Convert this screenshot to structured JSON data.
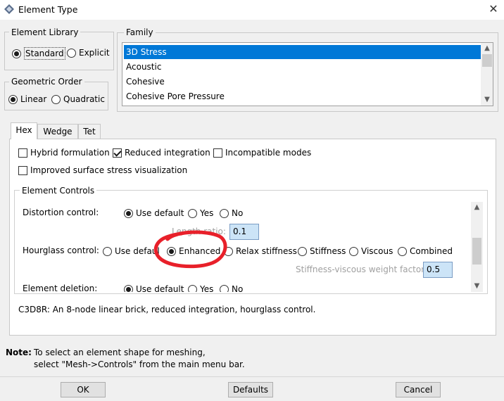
{
  "window": {
    "title": "Element Type",
    "close": "✕"
  },
  "element_library": {
    "title": "Element Library",
    "options": [
      "Standard",
      "Explicit"
    ],
    "selected": "Standard"
  },
  "geometric_order": {
    "title": "Geometric Order",
    "options": [
      "Linear",
      "Quadratic"
    ],
    "selected": "Linear"
  },
  "family": {
    "title": "Family",
    "items": [
      "3D Stress",
      "Acoustic",
      "Cohesive",
      "Cohesive Pore Pressure"
    ],
    "selected": "3D Stress"
  },
  "tabs": {
    "items": [
      "Hex",
      "Wedge",
      "Tet"
    ],
    "active": "Hex"
  },
  "options": {
    "hybrid": {
      "label": "Hybrid formulation",
      "checked": false
    },
    "reduced": {
      "label": "Reduced integration",
      "checked": true
    },
    "incompatible": {
      "label": "Incompatible modes",
      "checked": false
    },
    "improved": {
      "label": "Improved surface stress visualization",
      "checked": false
    }
  },
  "element_controls": {
    "title": "Element Controls",
    "distortion": {
      "label": "Distortion control:",
      "use_default": "Use default",
      "yes": "Yes",
      "no": "No"
    },
    "length_ratio": {
      "label": "Length ratio:",
      "value": "0.1"
    },
    "hourglass": {
      "label": "Hourglass control:",
      "options": [
        "Use default",
        "Enhanced",
        "Relax stiffness",
        "Stiffness",
        "Viscous",
        "Combined"
      ],
      "selected": "Enhanced"
    },
    "weight": {
      "label": "Stiffness-viscous weight factor",
      "value": "0.5"
    },
    "deletion": {
      "label": "Element deletion:",
      "use_default": "Use default",
      "yes": "Yes",
      "no": "No"
    }
  },
  "description": "C3D8R:  An 8-node linear brick, reduced integration, hourglass control.",
  "note": {
    "label": "Note:",
    "line1": "To select an element shape for meshing,",
    "line2": "select \"Mesh->Controls\" from the main menu bar."
  },
  "buttons": {
    "ok": "OK",
    "defaults": "Defaults",
    "cancel": "Cancel"
  },
  "annotation_color": "#e8202a",
  "accent_color": "#0078d7"
}
